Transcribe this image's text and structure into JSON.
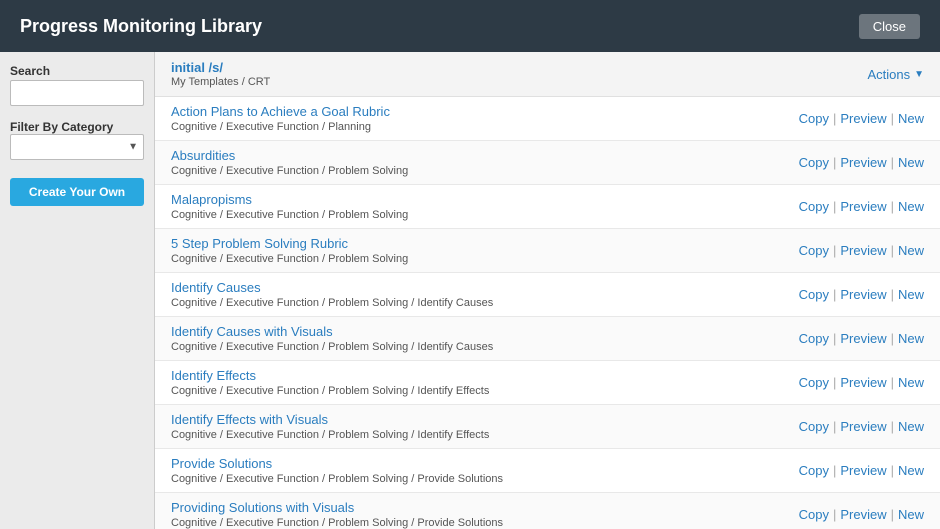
{
  "header": {
    "title": "Progress Monitoring Library",
    "close_label": "Close"
  },
  "sidebar": {
    "search_label": "Search",
    "search_placeholder": "",
    "filter_label": "Filter By Category",
    "create_btn_label": "Create Your Own"
  },
  "list_header": {
    "title": "initial /s/",
    "breadcrumb": "My Templates / CRT",
    "actions_label": "Actions"
  },
  "items": [
    {
      "name": "Action Plans to Achieve a Goal Rubric",
      "category": "Cognitive / Executive Function / Planning",
      "copy": "Copy",
      "preview": "Preview",
      "new": "New"
    },
    {
      "name": "Absurdities",
      "category": "Cognitive / Executive Function / Problem Solving",
      "copy": "Copy",
      "preview": "Preview",
      "new": "New"
    },
    {
      "name": "Malapropisms",
      "category": "Cognitive / Executive Function / Problem Solving",
      "copy": "Copy",
      "preview": "Preview",
      "new": "New"
    },
    {
      "name": "5 Step Problem Solving Rubric",
      "category": "Cognitive / Executive Function / Problem Solving",
      "copy": "Copy",
      "preview": "Preview",
      "new": "New"
    },
    {
      "name": "Identify Causes",
      "category": "Cognitive / Executive Function / Problem Solving / Identify Causes",
      "copy": "Copy",
      "preview": "Preview",
      "new": "New"
    },
    {
      "name": "Identify Causes with Visuals",
      "category": "Cognitive / Executive Function / Problem Solving / Identify Causes",
      "copy": "Copy",
      "preview": "Preview",
      "new": "New"
    },
    {
      "name": "Identify Effects",
      "category": "Cognitive / Executive Function / Problem Solving / Identify Effects",
      "copy": "Copy",
      "preview": "Preview",
      "new": "New"
    },
    {
      "name": "Identify Effects with Visuals",
      "category": "Cognitive / Executive Function / Problem Solving / Identify Effects",
      "copy": "Copy",
      "preview": "Preview",
      "new": "New"
    },
    {
      "name": "Provide Solutions",
      "category": "Cognitive / Executive Function / Problem Solving / Provide Solutions",
      "copy": "Copy",
      "preview": "Preview",
      "new": "New"
    },
    {
      "name": "Providing Solutions with Visuals",
      "category": "Cognitive / Executive Function / Problem Solving / Provide Solutions",
      "copy": "Copy",
      "preview": "Preview",
      "new": "New"
    }
  ]
}
